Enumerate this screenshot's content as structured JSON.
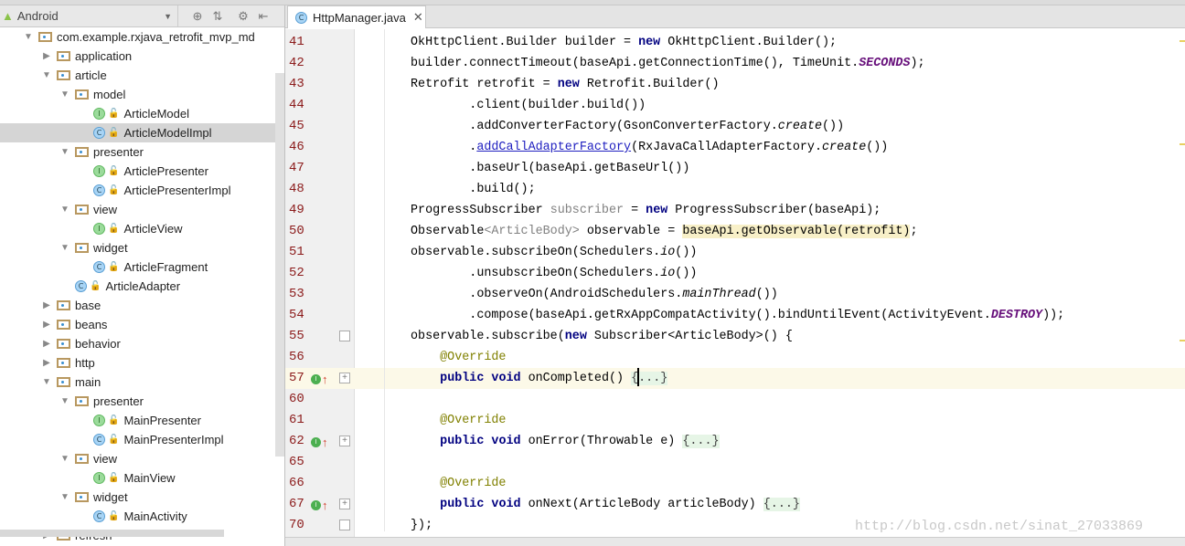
{
  "sidebar": {
    "view_label": "Android",
    "items": [
      {
        "label": "com.example.rxjava_retrofit_mvp_md",
        "kind": "package",
        "level": 0,
        "expanded": true
      },
      {
        "label": "application",
        "kind": "folder",
        "level": 1,
        "expanded": false
      },
      {
        "label": "article",
        "kind": "folder",
        "level": 1,
        "expanded": true
      },
      {
        "label": "model",
        "kind": "folder",
        "level": 2,
        "expanded": true
      },
      {
        "label": "ArticleModel",
        "kind": "I",
        "level": 3
      },
      {
        "label": "ArticleModelImpl",
        "kind": "C",
        "level": 3,
        "selected": true
      },
      {
        "label": "presenter",
        "kind": "folder",
        "level": 2,
        "expanded": true
      },
      {
        "label": "ArticlePresenter",
        "kind": "I",
        "level": 3
      },
      {
        "label": "ArticlePresenterImpl",
        "kind": "C",
        "level": 3
      },
      {
        "label": "view",
        "kind": "folder",
        "level": 2,
        "expanded": true
      },
      {
        "label": "ArticleView",
        "kind": "I",
        "level": 3
      },
      {
        "label": "widget",
        "kind": "folder",
        "level": 2,
        "expanded": true
      },
      {
        "label": "ArticleFragment",
        "kind": "C",
        "level": 3
      },
      {
        "label": "ArticleAdapter",
        "kind": "C",
        "level": 2
      },
      {
        "label": "base",
        "kind": "folder",
        "level": 1,
        "expanded": false
      },
      {
        "label": "beans",
        "kind": "folder",
        "level": 1,
        "expanded": false
      },
      {
        "label": "behavior",
        "kind": "folder",
        "level": 1,
        "expanded": false
      },
      {
        "label": "http",
        "kind": "folder",
        "level": 1,
        "expanded": false
      },
      {
        "label": "main",
        "kind": "folder",
        "level": 1,
        "expanded": true
      },
      {
        "label": "presenter",
        "kind": "folder",
        "level": 2,
        "expanded": true
      },
      {
        "label": "MainPresenter",
        "kind": "I",
        "level": 3
      },
      {
        "label": "MainPresenterImpl",
        "kind": "C",
        "level": 3
      },
      {
        "label": "view",
        "kind": "folder",
        "level": 2,
        "expanded": true
      },
      {
        "label": "MainView",
        "kind": "I",
        "level": 3
      },
      {
        "label": "widget",
        "kind": "folder",
        "level": 2,
        "expanded": true
      },
      {
        "label": "MainActivity",
        "kind": "C",
        "level": 3
      },
      {
        "label": "refresh",
        "kind": "folder",
        "level": 1,
        "expanded": false
      }
    ]
  },
  "editor": {
    "tab_label": "HttpManager.java",
    "lines": [
      {
        "n": "41",
        "segs": [
          [
            "",
            "OkHttpClient.Builder builder = "
          ],
          [
            "kw",
            "new"
          ],
          [
            "",
            " OkHttpClient.Builder();"
          ]
        ]
      },
      {
        "n": "42",
        "segs": [
          [
            "",
            "builder.connectTimeout(baseApi.getConnectionTime(), TimeUnit."
          ],
          [
            "cs",
            "SECONDS"
          ],
          [
            "",
            ");"
          ]
        ]
      },
      {
        "n": "43",
        "segs": [
          [
            "",
            "Retrofit retrofit = "
          ],
          [
            "kw",
            "new"
          ],
          [
            "",
            " Retrofit.Builder()"
          ]
        ]
      },
      {
        "n": "44",
        "segs": [
          [
            "",
            "        .client(builder.build())"
          ]
        ]
      },
      {
        "n": "45",
        "segs": [
          [
            "",
            "        .addConverterFactory(GsonConverterFactory."
          ],
          [
            "it",
            "create"
          ],
          [
            "",
            "())"
          ]
        ]
      },
      {
        "n": "46",
        "segs": [
          [
            "",
            "        ."
          ],
          [
            "lk",
            "addCallAdapterFactory"
          ],
          [
            "",
            "(RxJavaCallAdapterFactory."
          ],
          [
            "it",
            "create"
          ],
          [
            "",
            "())"
          ]
        ]
      },
      {
        "n": "47",
        "segs": [
          [
            "",
            "        .baseUrl(baseApi.getBaseUrl())"
          ]
        ]
      },
      {
        "n": "48",
        "segs": [
          [
            "",
            "        .build();"
          ]
        ]
      },
      {
        "n": "49",
        "segs": [
          [
            "",
            "ProgressSubscriber "
          ],
          [
            "gr",
            "subscriber"
          ],
          [
            "",
            " = "
          ],
          [
            "kw",
            "new"
          ],
          [
            "",
            " ProgressSubscriber(baseApi);"
          ]
        ]
      },
      {
        "n": "50",
        "segs": [
          [
            "",
            "Observable"
          ],
          [
            "gr",
            "<ArticleBody>"
          ],
          [
            "",
            " observable = "
          ],
          [
            "hl",
            "baseApi.getObservable(retrofit)"
          ],
          [
            "",
            ";"
          ]
        ]
      },
      {
        "n": "51",
        "segs": [
          [
            "",
            "observable.subscribeOn(Schedulers."
          ],
          [
            "it",
            "io"
          ],
          [
            "",
            "())"
          ]
        ]
      },
      {
        "n": "52",
        "segs": [
          [
            "",
            "        .unsubscribeOn(Schedulers."
          ],
          [
            "it",
            "io"
          ],
          [
            "",
            "())"
          ]
        ]
      },
      {
        "n": "53",
        "segs": [
          [
            "",
            "        .observeOn(AndroidSchedulers."
          ],
          [
            "it",
            "mainThread"
          ],
          [
            "",
            "())"
          ]
        ]
      },
      {
        "n": "54",
        "segs": [
          [
            "",
            "        .compose(baseApi.getRxAppCompatActivity().bindUntilEvent(ActivityEvent."
          ],
          [
            "cs",
            "DESTROY"
          ],
          [
            "",
            "));"
          ]
        ]
      },
      {
        "n": "55",
        "segs": [
          [
            "",
            "observable.subscribe("
          ],
          [
            "kw",
            "new"
          ],
          [
            "",
            " Subscriber<ArticleBody>() {"
          ]
        ]
      },
      {
        "n": "56",
        "segs": [
          [
            "an",
            "    @Override"
          ]
        ]
      },
      {
        "n": "57",
        "segs": [
          [
            "",
            "    "
          ],
          [
            "kw",
            "public void"
          ],
          [
            "",
            " onCompleted() "
          ],
          [
            "fold",
            "{...}"
          ]
        ]
      },
      {
        "n": "60",
        "segs": []
      },
      {
        "n": "61",
        "segs": [
          [
            "an",
            "    @Override"
          ]
        ]
      },
      {
        "n": "62",
        "segs": [
          [
            "",
            "    "
          ],
          [
            "kw",
            "public void"
          ],
          [
            "",
            " onError(Throwable e) "
          ],
          [
            "fold",
            "{...}"
          ]
        ]
      },
      {
        "n": "65",
        "segs": []
      },
      {
        "n": "66",
        "segs": [
          [
            "an",
            "    @Override"
          ]
        ]
      },
      {
        "n": "67",
        "segs": [
          [
            "",
            "    "
          ],
          [
            "kw",
            "public void"
          ],
          [
            "",
            " onNext(ArticleBody articleBody) "
          ],
          [
            "fold",
            "{...}"
          ]
        ]
      },
      {
        "n": "70",
        "segs": [
          [
            "",
            "});"
          ]
        ]
      }
    ]
  },
  "watermark": "http://blog.csdn.net/sinat_27033869",
  "colors": {
    "keyword": "#000080",
    "annotation": "#808000",
    "constant": "#660e7a",
    "line_number": "#8b1a1a"
  }
}
